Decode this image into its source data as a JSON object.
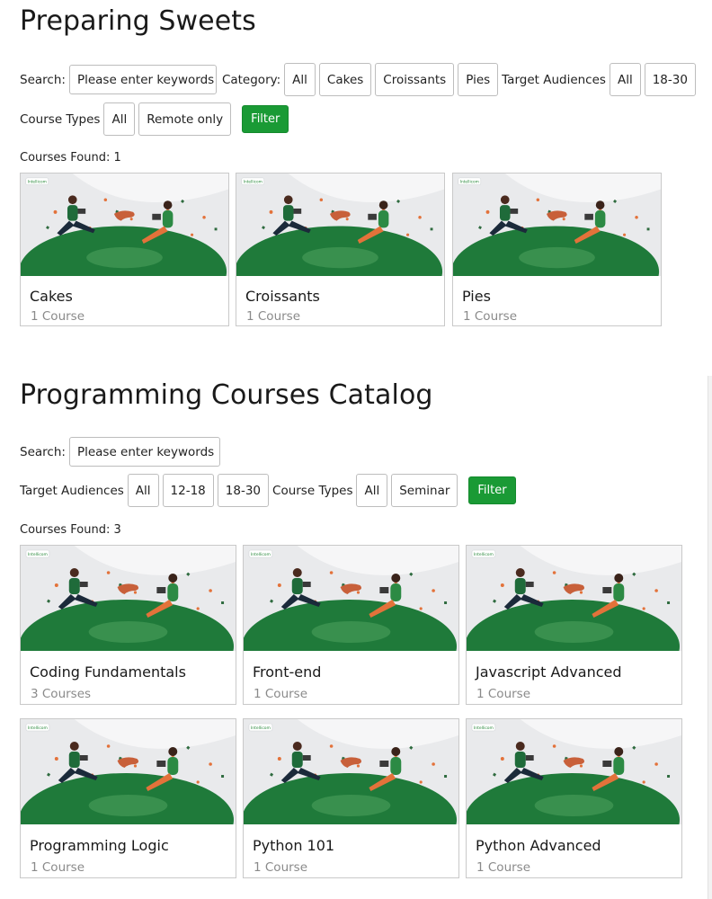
{
  "sections": [
    {
      "title": "Preparing Sweets",
      "search_label": "Search:",
      "search_placeholder": "Please enter keywords",
      "category_label": "Category:",
      "categories": [
        "All",
        "Cakes",
        "Croissants",
        "Pies"
      ],
      "audience_label": "Target Audiences",
      "audiences": [
        "All",
        "18-30"
      ],
      "course_types_label": "Course Types",
      "course_types": [
        "All",
        "Remote only"
      ],
      "filter_label": "Filter",
      "found": "Courses Found: 1",
      "cards": [
        {
          "name": "Cakes",
          "count": "1 Course"
        },
        {
          "name": "Croissants",
          "count": "1 Course"
        },
        {
          "name": "Pies",
          "count": "1 Course"
        }
      ]
    },
    {
      "title": "Programming Courses Catalog",
      "search_label": "Search:",
      "search_placeholder": "Please enter keywords",
      "audience_label": "Target Audiences",
      "audiences": [
        "All",
        "12-18",
        "18-30"
      ],
      "course_types_label": "Course Types",
      "course_types": [
        "All",
        "Seminar"
      ],
      "filter_label": "Filter",
      "found": "Courses Found: 3",
      "cards": [
        {
          "name": "Coding Fundamentals",
          "count": "3 Courses"
        },
        {
          "name": "Front-end",
          "count": "1 Course"
        },
        {
          "name": "Javascript Advanced",
          "count": "1 Course"
        },
        {
          "name": "Programming Logic",
          "count": "1 Course"
        },
        {
          "name": "Python 101",
          "count": "1 Course"
        },
        {
          "name": "Python Advanced",
          "count": "1 Course"
        }
      ]
    }
  ],
  "thumbnail": {
    "logo_text": "Intellicom",
    "illustration": "people-reading-on-green-hill-illustration"
  },
  "colors": {
    "accent_green": "#1a9a35",
    "hill_green": "#1f7a3a",
    "border": "#bdbdbd",
    "muted_text": "#8a8a8a"
  }
}
